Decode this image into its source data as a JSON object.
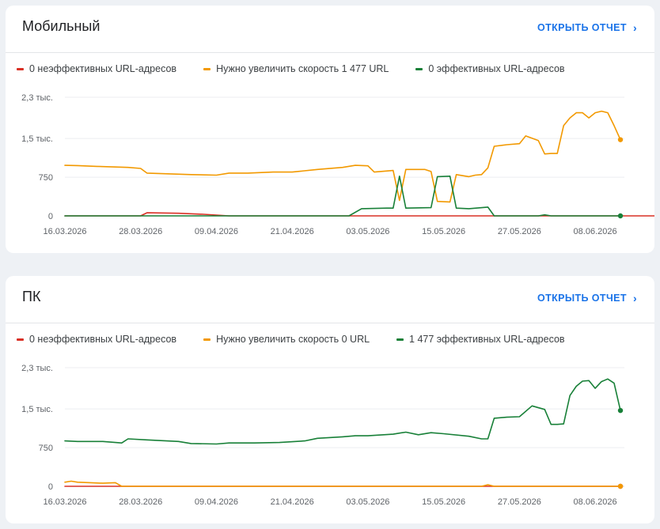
{
  "colors": {
    "poor": "#d93025",
    "improve": "#f29900",
    "good": "#188038",
    "link": "#1a73e8"
  },
  "x_labels": [
    "16.03.2026",
    "28.03.2026",
    "09.04.2026",
    "21.04.2026",
    "03.05.2026",
    "15.05.2026",
    "27.05.2026",
    "08.06.2026"
  ],
  "y_labels": [
    "0",
    "750",
    "1,5 тыс.",
    "2,3 тыс."
  ],
  "link_label": "ОТКРЫТЬ ОТЧЕТ",
  "mobile": {
    "title": "Мобильный",
    "legend": [
      "0 неэффективных URL-адресов",
      "Нужно увеличить скорость 1 477 URL",
      "0 эффективных URL-адресов"
    ]
  },
  "desktop": {
    "title": "ПК",
    "legend": [
      "0 неэффективных URL-адресов",
      "Нужно увеличить скорость 0 URL",
      "1 477 эффективных URL-адресов"
    ]
  },
  "chart_data": [
    {
      "type": "line",
      "title": "Мобильный",
      "x": [
        "16.03.2026",
        "28.03.2026",
        "09.04.2026",
        "21.04.2026",
        "03.05.2026",
        "15.05.2026",
        "27.05.2026",
        "08.06.2026"
      ],
      "ylim": [
        0,
        2300
      ],
      "grid": true,
      "legend_position": "top",
      "series": [
        {
          "name": "0 неэффективных URL-адресов",
          "color": "#d93025",
          "points": [
            [
              0,
              0
            ],
            [
              12,
              0
            ],
            [
              13,
              60
            ],
            [
              18,
              50
            ],
            [
              22,
              30
            ],
            [
              26,
              0
            ],
            [
              94,
              0
            ]
          ]
        },
        {
          "name": "Нужно увеличить скорость 1 477 URL",
          "color": "#f29900",
          "points": [
            [
              0,
              980
            ],
            [
              2,
              975
            ],
            [
              5,
              960
            ],
            [
              10,
              940
            ],
            [
              12,
              920
            ],
            [
              13,
              830
            ],
            [
              20,
              800
            ],
            [
              24,
              790
            ],
            [
              26,
              830
            ],
            [
              29,
              830
            ],
            [
              33,
              850
            ],
            [
              36,
              850
            ],
            [
              40,
              900
            ],
            [
              44,
              940
            ],
            [
              46,
              980
            ],
            [
              48,
              970
            ],
            [
              49,
              850
            ],
            [
              52,
              880
            ],
            [
              53,
              300
            ],
            [
              54,
              900
            ],
            [
              57,
              900
            ],
            [
              58,
              860
            ],
            [
              59,
              280
            ],
            [
              61,
              270
            ],
            [
              62,
              800
            ],
            [
              64,
              760
            ],
            [
              65,
              790
            ],
            [
              66,
              800
            ],
            [
              67,
              930
            ],
            [
              68,
              1350
            ],
            [
              70,
              1380
            ],
            [
              72,
              1400
            ],
            [
              73,
              1550
            ],
            [
              75,
              1460
            ],
            [
              76,
              1200
            ],
            [
              77,
              1210
            ],
            [
              78,
              1210
            ],
            [
              79,
              1750
            ],
            [
              80,
              1900
            ],
            [
              81,
              2000
            ],
            [
              82,
              2000
            ],
            [
              83,
              1900
            ],
            [
              84,
              2000
            ],
            [
              85,
              2030
            ],
            [
              86,
              2000
            ],
            [
              87,
              1750
            ],
            [
              88,
              1477
            ]
          ]
        },
        {
          "name": "0 эффективных URL-адресов",
          "color": "#188038",
          "points": [
            [
              0,
              0
            ],
            [
              12,
              0
            ],
            [
              13,
              0
            ],
            [
              22,
              0
            ],
            [
              24,
              0
            ],
            [
              45,
              0
            ],
            [
              47,
              140
            ],
            [
              51,
              150
            ],
            [
              52,
              150
            ],
            [
              53,
              770
            ],
            [
              54,
              150
            ],
            [
              58,
              160
            ],
            [
              59,
              760
            ],
            [
              61,
              770
            ],
            [
              62,
              150
            ],
            [
              64,
              140
            ],
            [
              67,
              170
            ],
            [
              68,
              0
            ],
            [
              75,
              0
            ],
            [
              76,
              20
            ],
            [
              77,
              0
            ],
            [
              88,
              0
            ]
          ]
        }
      ]
    },
    {
      "type": "line",
      "title": "ПК",
      "x": [
        "16.03.2026",
        "28.03.2026",
        "09.04.2026",
        "21.04.2026",
        "03.05.2026",
        "15.05.2026",
        "27.05.2026",
        "08.06.2026"
      ],
      "ylim": [
        0,
        2300
      ],
      "grid": true,
      "legend_position": "top",
      "series": [
        {
          "name": "0 неэффективных URL-адресов",
          "color": "#d93025",
          "points": [
            [
              0,
              0
            ],
            [
              88,
              0
            ]
          ]
        },
        {
          "name": "Нужно увеличить скорость 0 URL",
          "color": "#f29900",
          "points": [
            [
              0,
              80
            ],
            [
              1,
              100
            ],
            [
              2,
              80
            ],
            [
              4,
              70
            ],
            [
              6,
              60
            ],
            [
              8,
              70
            ],
            [
              9,
              0
            ],
            [
              66,
              0
            ],
            [
              67,
              30
            ],
            [
              68,
              0
            ],
            [
              88,
              0
            ]
          ]
        },
        {
          "name": "1 477 эффективных URL-адресов",
          "color": "#188038",
          "points": [
            [
              0,
              880
            ],
            [
              2,
              870
            ],
            [
              6,
              870
            ],
            [
              9,
              840
            ],
            [
              10,
              920
            ],
            [
              13,
              900
            ],
            [
              18,
              870
            ],
            [
              20,
              830
            ],
            [
              24,
              820
            ],
            [
              26,
              840
            ],
            [
              30,
              840
            ],
            [
              34,
              850
            ],
            [
              38,
              880
            ],
            [
              40,
              930
            ],
            [
              44,
              960
            ],
            [
              46,
              980
            ],
            [
              48,
              980
            ],
            [
              52,
              1010
            ],
            [
              54,
              1050
            ],
            [
              56,
              1000
            ],
            [
              58,
              1040
            ],
            [
              60,
              1020
            ],
            [
              64,
              970
            ],
            [
              66,
              920
            ],
            [
              67,
              920
            ],
            [
              68,
              1320
            ],
            [
              70,
              1340
            ],
            [
              72,
              1350
            ],
            [
              74,
              1560
            ],
            [
              76,
              1490
            ],
            [
              77,
              1200
            ],
            [
              78,
              1200
            ],
            [
              79,
              1210
            ],
            [
              80,
              1760
            ],
            [
              81,
              1940
            ],
            [
              82,
              2040
            ],
            [
              83,
              2050
            ],
            [
              84,
              1900
            ],
            [
              85,
              2030
            ],
            [
              86,
              2080
            ],
            [
              87,
              2000
            ],
            [
              88,
              1470
            ]
          ]
        }
      ]
    }
  ]
}
